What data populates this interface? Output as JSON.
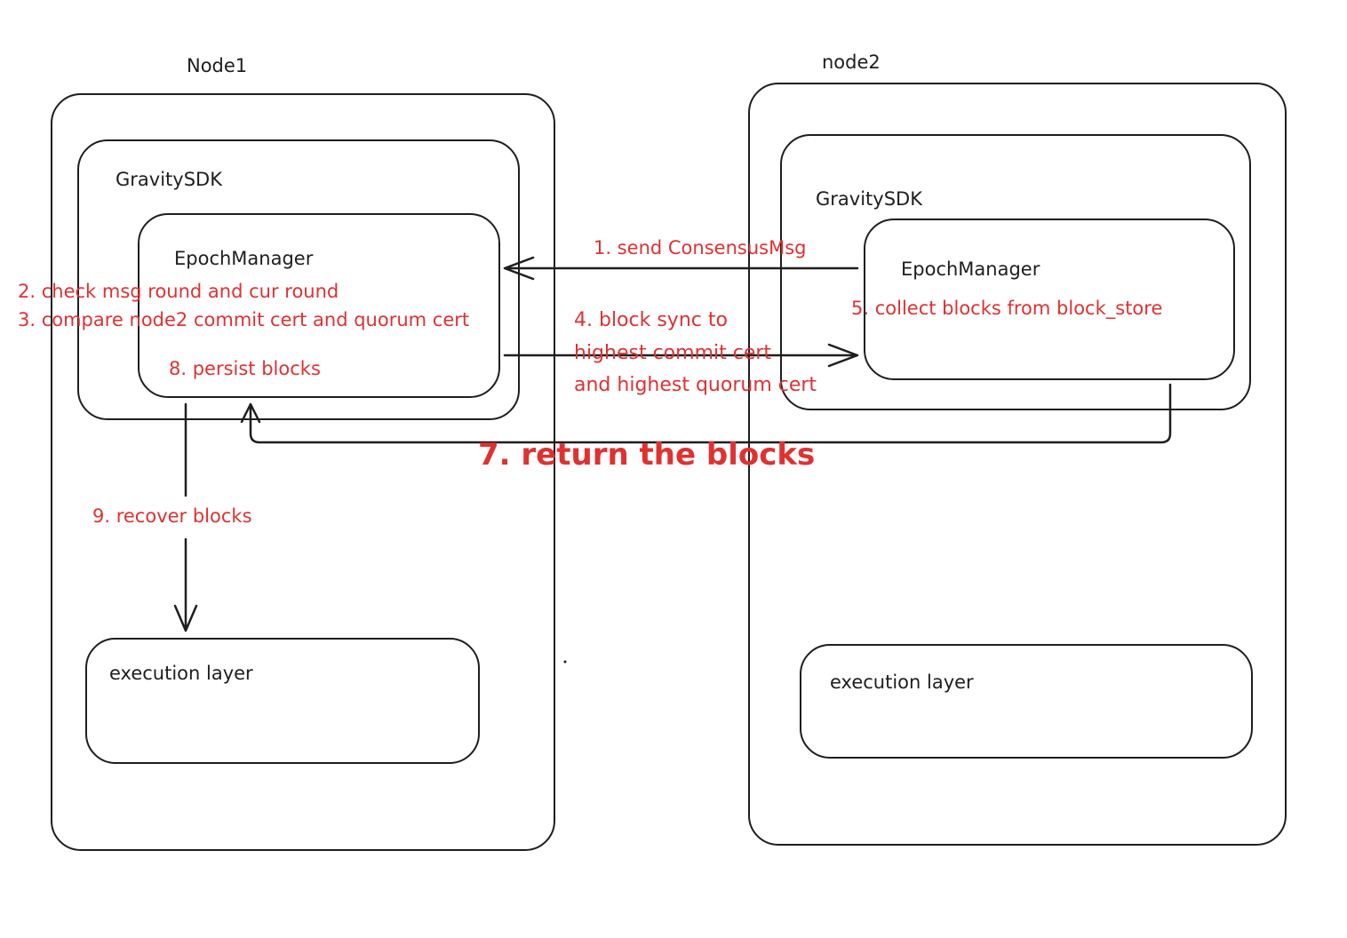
{
  "node1": {
    "title": "Node1",
    "sdk_label": "GravitySDK",
    "epoch_label": "EpochManager",
    "exec_label": "execution layer"
  },
  "node2": {
    "title": "node2",
    "sdk_label": "GravitySDK",
    "epoch_label": "EpochManager",
    "exec_label": "execution layer"
  },
  "steps": {
    "s1": "1. send ConsensusMsg",
    "s2": "2. check msg round and cur round",
    "s3": "3. compare node2 commit cert and quorum cert",
    "s4a": "4. block sync to",
    "s4b": "highest commit cert",
    "s4c": "and highest quorum cert",
    "s5": "5. collect blocks from block_store",
    "s7": "7. return the blocks",
    "s8": "8. persist blocks",
    "s9": "9. recover blocks"
  },
  "colors": {
    "stroke": "#1e1e1e",
    "accent": "#e03131"
  }
}
